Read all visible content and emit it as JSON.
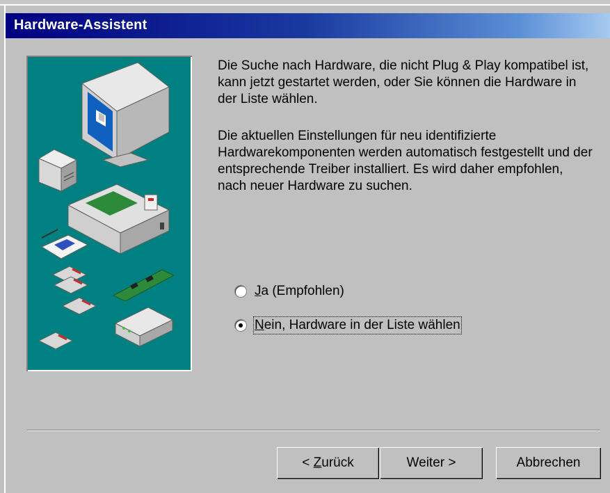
{
  "window": {
    "title": "Hardware-Assistent"
  },
  "content": {
    "paragraph1": "Die Suche nach Hardware, die nicht Plug & Play kompatibel ist, kann jetzt gestartet werden, oder Sie können die Hardware in der Liste wählen.",
    "paragraph2": "Die aktuellen Einstellungen für neu identifizierte Hardwarekomponenten werden automatisch festgestellt und der entsprechende Treiber installiert. Es wird daher empfohlen, nach neuer Hardware zu suchen."
  },
  "options": [
    {
      "mnemonic": "J",
      "rest": "a (Empfohlen)",
      "selected": false
    },
    {
      "mnemonic": "N",
      "rest": "ein, Hardware in der Liste wählen",
      "selected": true
    }
  ],
  "buttons": {
    "back_prefix": "< ",
    "back_mnemonic": "Z",
    "back_rest": "urück",
    "next": "Weiter >",
    "cancel": "Abbrechen"
  },
  "colors": {
    "titlebar_start": "#000080",
    "titlebar_end": "#a6caf0",
    "illustration_bg": "#008080",
    "dialog_bg": "#c0c0c0"
  }
}
